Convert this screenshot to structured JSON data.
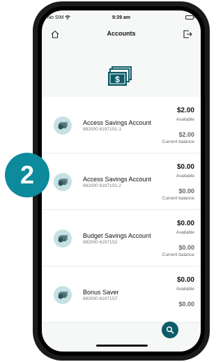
{
  "status_bar": {
    "carrier": "No SIM",
    "time": "9:39 am"
  },
  "nav": {
    "title": "Accounts"
  },
  "accounts": [
    {
      "name": "Access Savings Account",
      "number": "882000 61971S1.1",
      "available": "$2.00",
      "available_label": "Available",
      "current": "$2.00",
      "current_label": "Current balance"
    },
    {
      "name": "Access Savings Account",
      "number": "882000 61971S1.2",
      "available": "$0.00",
      "available_label": "Available",
      "current": "$0.00",
      "current_label": "Current balance"
    },
    {
      "name": "Budget Savings Account",
      "number": "882000 61971S2",
      "available": "$0.00",
      "available_label": "Available",
      "current": "$0.00",
      "current_label": "Current balance"
    },
    {
      "name": "Bonus Saver",
      "number": "882000 61971S7",
      "available": "$0.00",
      "available_label": "Available",
      "current": "$0.00",
      "current_label": ""
    }
  ],
  "badge": {
    "number": "2"
  },
  "colors": {
    "accent": "#0d5c67",
    "badge": "#0d8a9c",
    "icon_bg": "#c5e1e3"
  },
  "icons": {
    "home": "home-icon",
    "logout": "logout-icon",
    "hero": "money-stack-icon",
    "search": "search-icon",
    "account": "cash-icon"
  }
}
